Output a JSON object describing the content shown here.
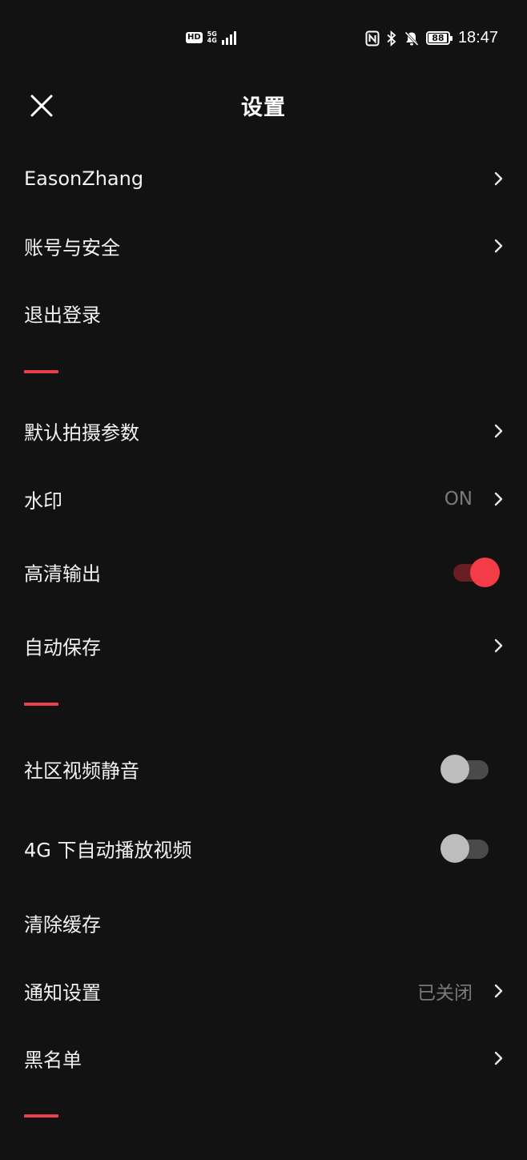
{
  "status_bar": {
    "hd_label": "HD",
    "network_top": "5G",
    "network_bottom": "4G",
    "battery_level": "88",
    "time": "18:47"
  },
  "header": {
    "title": "设置",
    "close_icon": "close-icon"
  },
  "colors": {
    "background": "#121212",
    "accent": "#f23d48",
    "divider": "#e8404a",
    "secondary_text": "#7a7a7a"
  },
  "sections": [
    {
      "items": [
        {
          "label": "EasonZhang",
          "chevron": true
        },
        {
          "label": "账号与安全",
          "chevron": true
        },
        {
          "label": "退出登录",
          "chevron": false
        }
      ]
    },
    {
      "items": [
        {
          "label": "默认拍摄参数",
          "chevron": true
        },
        {
          "label": "水印",
          "value": "ON",
          "chevron": true
        },
        {
          "label": "高清输出",
          "toggle": true,
          "toggle_on": true
        },
        {
          "label": "自动保存",
          "chevron": true
        }
      ]
    },
    {
      "items": [
        {
          "label": "社区视频静音",
          "toggle": true,
          "toggle_on": false
        },
        {
          "label": "4G 下自动播放视频",
          "toggle": true,
          "toggle_on": false
        },
        {
          "label": "清除缓存",
          "chevron": false
        },
        {
          "label": "通知设置",
          "value": "已关闭",
          "chevron": true
        },
        {
          "label": "黑名单",
          "chevron": true
        }
      ]
    }
  ]
}
